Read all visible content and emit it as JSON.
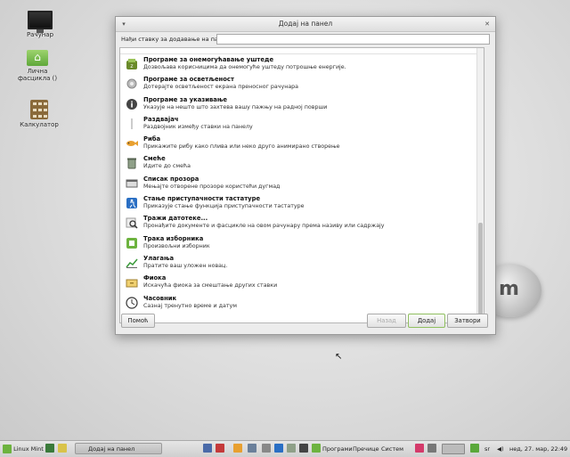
{
  "desktop": {
    "icons": [
      {
        "label": "Рачунар",
        "icon": "computer-icon"
      },
      {
        "label": "Лична фасцикла ()",
        "icon": "home-folder-icon"
      },
      {
        "label": "Калкулатор",
        "icon": "calculator-icon"
      }
    ]
  },
  "dialog": {
    "title": "Додај на панел",
    "search_label": "Нађи ставку за додавање на панел:",
    "search_value": "",
    "items": [
      {
        "title": "Програме за онемогућавање уштеде",
        "desc": "Дозвољава корисницима да онемогуће уштеду потрошње енергије.",
        "icon": "power-inhibit-icon"
      },
      {
        "title": "Програме за осветљеност",
        "desc": "Дотерајте осветљеност екрана преносног рачунара",
        "icon": "brightness-gear-icon"
      },
      {
        "title": "Програме за указивање",
        "desc": "Указује на нешто што захтева вашу пажњу на радној површи",
        "icon": "info-icon"
      },
      {
        "title": "Раздвајач",
        "desc": "Раздвојник између ставки на панелу",
        "icon": "separator-icon"
      },
      {
        "title": "Риба",
        "desc": "Прикажите рибу како плива или неко друго анимирано створење",
        "icon": "fish-icon"
      },
      {
        "title": "Смеће",
        "desc": "Идите до смећа",
        "icon": "trash-icon"
      },
      {
        "title": "Списак прозора",
        "desc": "Мењајте отворене прозоре користећи дугмад",
        "icon": "window-list-icon"
      },
      {
        "title": "Стање приступачности тастатуре",
        "desc": "Приказује стање функција приступачности тастатуре",
        "icon": "accessibility-icon"
      },
      {
        "title": "Тражи датотеке...",
        "desc": "Пронађите документе и фасцикле на овом рачунару према називу или садржају",
        "icon": "search-files-icon"
      },
      {
        "title": "Трака изборника",
        "desc": "Произвољни изборник",
        "icon": "menu-bar-icon"
      },
      {
        "title": "Улагања",
        "desc": "Пратите ваш уложен новац.",
        "icon": "investments-icon"
      },
      {
        "title": "Фиока",
        "desc": "Искачућа фиока за смештање других ставки",
        "icon": "drawer-icon"
      },
      {
        "title": "Часовник",
        "desc": "Сазнај тренутно време и датум",
        "icon": "clock-icon"
      }
    ],
    "buttons": {
      "help": "Помоћ",
      "back": "Назад",
      "add": "Додај",
      "close": "Затвори"
    }
  },
  "taskbar": {
    "menu_label": "Linux Mint",
    "window_title": "Додај на панел",
    "menus": [
      "Програми",
      "Пречице",
      "Систем"
    ],
    "keyboard_layout": "sr",
    "clock": "нед, 27. мар, 22:49"
  },
  "colors": {
    "accent_green": "#6db33f",
    "dialog_bg": "#ececec"
  }
}
